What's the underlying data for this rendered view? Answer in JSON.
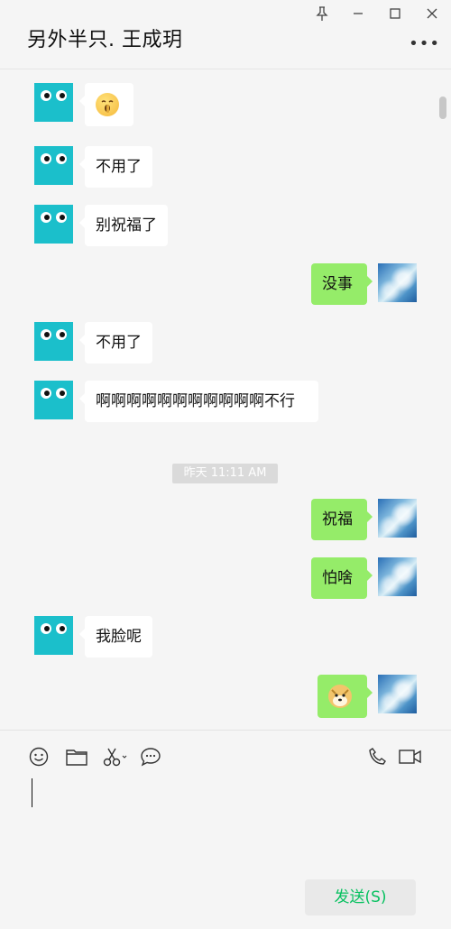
{
  "header": {
    "title": "另外半只. 王成玥"
  },
  "window": {
    "pin_icon": "pin-icon",
    "minimize_icon": "minimize-icon",
    "maximize_icon": "maximize-icon",
    "close_icon": "close-icon",
    "more_icon": "more-icon"
  },
  "messages": [
    {
      "side": "left",
      "type": "emoji",
      "emoji": "shh-face"
    },
    {
      "side": "left",
      "type": "text",
      "text": "不用了"
    },
    {
      "side": "left",
      "type": "text",
      "text": "别祝福了"
    },
    {
      "side": "right",
      "type": "text",
      "text": "没事"
    },
    {
      "side": "left",
      "type": "text",
      "text": "不用了"
    },
    {
      "side": "left",
      "type": "text",
      "text": "啊啊啊啊啊啊啊啊啊啊啊不行"
    },
    {
      "side": "right",
      "type": "text",
      "text": "祝福"
    },
    {
      "side": "right",
      "type": "text",
      "text": "怕啥"
    },
    {
      "side": "left",
      "type": "text",
      "text": "我脸呢"
    },
    {
      "side": "right",
      "type": "emoji",
      "emoji": "doge"
    }
  ],
  "timestamp": "昨天 11:11 AM",
  "toolbar": {
    "icons": [
      "emoji-icon",
      "folder-icon",
      "scissors-icon",
      "chat-bubble-icon",
      "phone-icon",
      "video-icon"
    ],
    "send_label": "发送(S)"
  }
}
